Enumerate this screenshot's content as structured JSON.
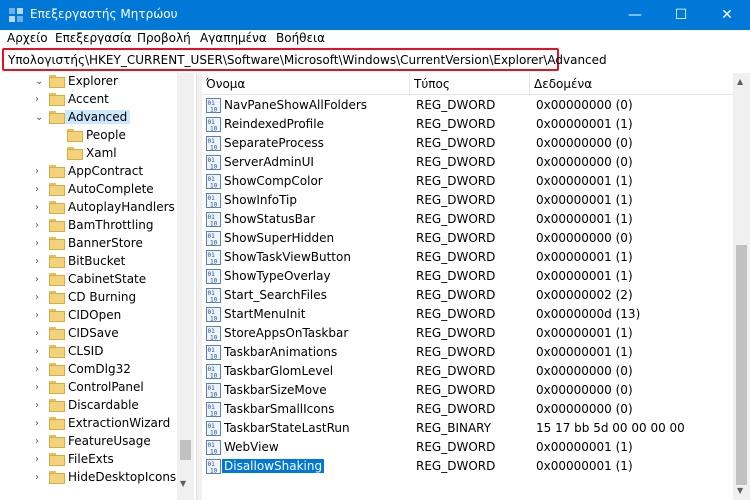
{
  "window": {
    "title": "Επεξεργαστής Μητρώου",
    "minimize_glyph": "—",
    "maximize_glyph": "☐",
    "close_glyph": "✕"
  },
  "menu": [
    "Αρχείο",
    "Επεξεργασία",
    "Προβολή",
    "Αγαπημένα",
    "Βοήθεια"
  ],
  "address": "Υπολογιστής\\HKEY_CURRENT_USER\\Software\\Microsoft\\Windows\\CurrentVersion\\Explorer\\Advanced",
  "tree": [
    {
      "label": "Explorer",
      "expanded": true
    },
    {
      "label": "Accent",
      "expanded": false
    },
    {
      "label": "Advanced",
      "expanded": true,
      "selected": true
    },
    {
      "label": "People"
    },
    {
      "label": "Xaml"
    },
    {
      "label": "AppContract",
      "expanded": false
    },
    {
      "label": "AutoComplete",
      "expanded": false
    },
    {
      "label": "AutoplayHandlers",
      "expanded": false
    },
    {
      "label": "BamThrottling",
      "expanded": false
    },
    {
      "label": "BannerStore",
      "expanded": false
    },
    {
      "label": "BitBucket",
      "expanded": false
    },
    {
      "label": "CabinetState",
      "expanded": false
    },
    {
      "label": "CD Burning",
      "expanded": false
    },
    {
      "label": "CIDOpen",
      "expanded": false
    },
    {
      "label": "CIDSave",
      "expanded": false
    },
    {
      "label": "CLSID",
      "expanded": false
    },
    {
      "label": "ComDlg32",
      "expanded": false
    },
    {
      "label": "ControlPanel",
      "expanded": false
    },
    {
      "label": "Discardable",
      "expanded": false
    },
    {
      "label": "ExtractionWizard",
      "expanded": false
    },
    {
      "label": "FeatureUsage",
      "expanded": false
    },
    {
      "label": "FileExts",
      "expanded": false
    },
    {
      "label": "HideDesktopIcons",
      "expanded": false
    }
  ],
  "columns": {
    "name": "Όνομα",
    "type": "Τύπος",
    "data": "Δεδομένα"
  },
  "values": [
    {
      "name": "NavPaneShowAllFolders",
      "type": "REG_DWORD",
      "data": "0x00000000 (0)"
    },
    {
      "name": "ReindexedProfile",
      "type": "REG_DWORD",
      "data": "0x00000001 (1)"
    },
    {
      "name": "SeparateProcess",
      "type": "REG_DWORD",
      "data": "0x00000000 (0)"
    },
    {
      "name": "ServerAdminUI",
      "type": "REG_DWORD",
      "data": "0x00000000 (0)"
    },
    {
      "name": "ShowCompColor",
      "type": "REG_DWORD",
      "data": "0x00000001 (1)"
    },
    {
      "name": "ShowInfoTip",
      "type": "REG_DWORD",
      "data": "0x00000001 (1)"
    },
    {
      "name": "ShowStatusBar",
      "type": "REG_DWORD",
      "data": "0x00000001 (1)"
    },
    {
      "name": "ShowSuperHidden",
      "type": "REG_DWORD",
      "data": "0x00000000 (0)"
    },
    {
      "name": "ShowTaskViewButton",
      "type": "REG_DWORD",
      "data": "0x00000001 (1)"
    },
    {
      "name": "ShowTypeOverlay",
      "type": "REG_DWORD",
      "data": "0x00000001 (1)"
    },
    {
      "name": "Start_SearchFiles",
      "type": "REG_DWORD",
      "data": "0x00000002 (2)"
    },
    {
      "name": "StartMenuInit",
      "type": "REG_DWORD",
      "data": "0x0000000d (13)"
    },
    {
      "name": "StoreAppsOnTaskbar",
      "type": "REG_DWORD",
      "data": "0x00000001 (1)"
    },
    {
      "name": "TaskbarAnimations",
      "type": "REG_DWORD",
      "data": "0x00000001 (1)"
    },
    {
      "name": "TaskbarGlomLevel",
      "type": "REG_DWORD",
      "data": "0x00000000 (0)"
    },
    {
      "name": "TaskbarSizeMove",
      "type": "REG_DWORD",
      "data": "0x00000000 (0)"
    },
    {
      "name": "TaskbarSmallIcons",
      "type": "REG_DWORD",
      "data": "0x00000000 (0)"
    },
    {
      "name": "TaskbarStateLastRun",
      "type": "REG_BINARY",
      "data": "15 17 bb 5d 00 00 00 00"
    },
    {
      "name": "WebView",
      "type": "REG_DWORD",
      "data": "0x00000001 (1)"
    },
    {
      "name": "DisallowShaking",
      "type": "REG_DWORD",
      "data": "0x00000001 (1)",
      "selected": true
    }
  ],
  "colors": {
    "titlebar": "#0078d7",
    "address_highlight": "#e81123",
    "selection": "#0078d7",
    "folder": "#f4d27a"
  },
  "icons": {
    "app": "registry-editor-icon",
    "value": "reg-dword-icon",
    "folder": "folder-icon",
    "expand": "chevron-right-icon",
    "collapse": "chevron-down-icon"
  }
}
